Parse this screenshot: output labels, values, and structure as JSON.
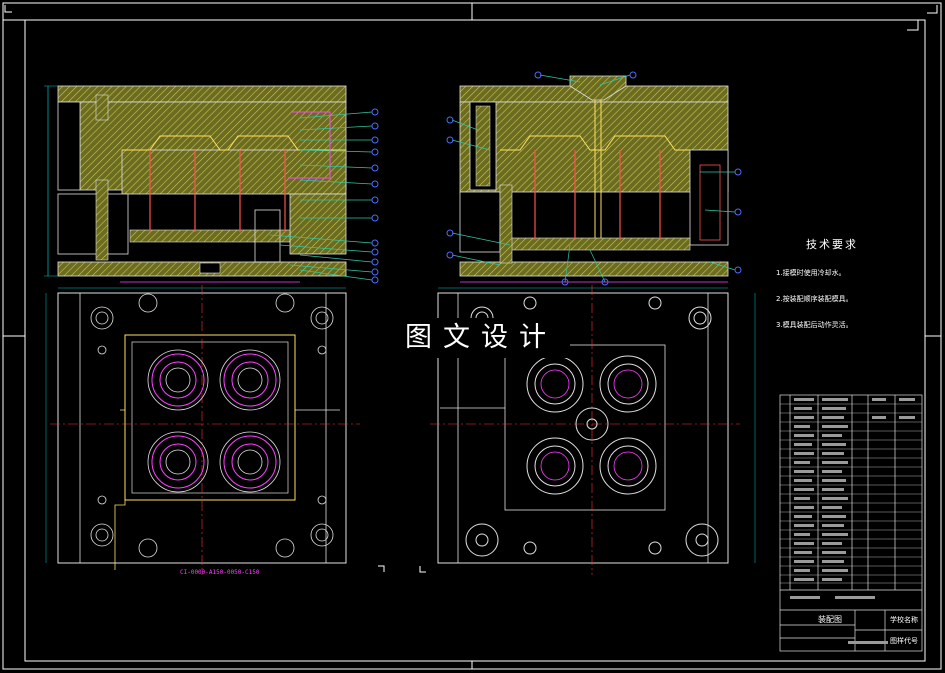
{
  "watermark": "图文设计",
  "technical_requirements": {
    "title": "技术要求",
    "lines": [
      "1.接模时使用冷却水。",
      "2.按装配顺序装配模具。",
      "3.模具装配后动作灵活。"
    ]
  },
  "title_block": {
    "drawing_name": "装配图",
    "school_label": "学校名称",
    "drawing_code_label": "图样代号"
  },
  "dimension_note": "CI-0000-A150-0050-C150",
  "colors": {
    "background": "#000000",
    "frame": "#ffffff",
    "plate_fill": "#7a7a2a",
    "plate_hatch": "#c8c84a",
    "outline": "#e0e0e0",
    "cavity_lines": "#ff40ff",
    "dimension": "#00c8c8",
    "center_line": "#ff3030",
    "balloon": "#4a6cff",
    "leader": "#30c8a0",
    "pin": "#ff5050"
  }
}
